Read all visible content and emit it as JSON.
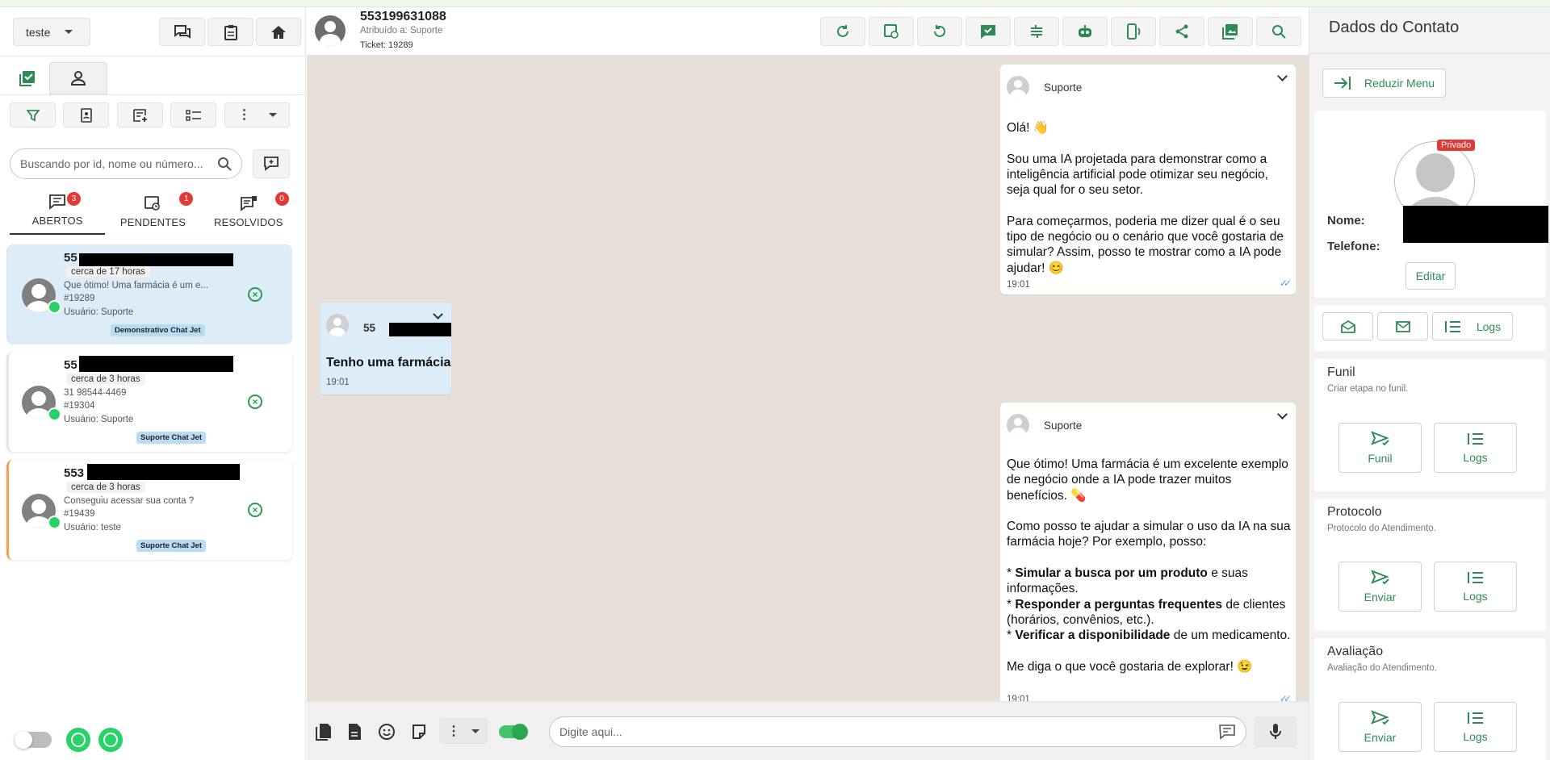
{
  "left": {
    "queue": "teste",
    "search_placeholder": "Buscando por id, nome ou número...",
    "tabs": [
      {
        "label": "ABERTOS",
        "badge": "3"
      },
      {
        "label": "PENDENTES",
        "badge": "1"
      },
      {
        "label": "RESOLVIDOS",
        "badge": "0"
      }
    ],
    "tickets": [
      {
        "number": "55",
        "time": "cerca de 17 horas",
        "preview": "Que ótimo! Uma farmácia é um e...",
        "id": "#19289",
        "user": "Usuário: Suporte",
        "tag": "Demonstrativo Chat Jet"
      },
      {
        "number": "55",
        "time": "cerca de 3 horas",
        "preview": "31 98544-4469",
        "id": "#19304",
        "user": "Usuário: Suporte",
        "tag": "Suporte Chat Jet"
      },
      {
        "number": "553",
        "time": "cerca de 3 horas",
        "preview": "Conseguiu acessar sua conta ?",
        "id": "#19439",
        "user": "Usuário: teste",
        "tag": "Suporte Chat Jet"
      }
    ]
  },
  "header": {
    "number": "553199631088",
    "assigned": "Atribuído a: Suporte",
    "ticket": "Ticket: 19289"
  },
  "messages": [
    {
      "sender": "Suporte",
      "body": "Olá! 👋\n\nSou uma IA projetada para demonstrar como a inteligência artificial pode otimizar seu negócio, seja qual for o seu setor.\n\nPara começarmos, poderia me dizer qual é o seu tipo de negócio ou o cenário que você gostaria de simular? Assim, posso te mostrar como a IA pode ajudar! 😊",
      "time": "19:01"
    },
    {
      "sender": "55",
      "body": "Tenho uma farmácia",
      "time": "19:01"
    },
    {
      "sender": "Suporte",
      "body_html": "Que ótimo! Uma farmácia é um excelente exemplo de negócio onde a IA pode trazer muitos benefícios. 💊\n\nComo posso te ajudar a simular o uso da IA na sua farmácia hoje? Por exemplo, posso:\n\n* <b>Simular a busca por um produto</b> e suas informações.\n* <b>Responder a perguntas frequentes</b> de clientes (horários, convênios, etc.).\n* <b>Verificar a disponibilidade</b> de um medicamento.\n\nMe diga o que você gostaria de explorar! 😉",
      "time": "19:01"
    }
  ],
  "composer": {
    "placeholder": "Digite aqui..."
  },
  "right": {
    "title": "Dados do Contato",
    "reduce": "Reduzir Menu",
    "private": "Privado",
    "name_label": "Nome:",
    "phone_label": "Telefone:",
    "edit": "Editar",
    "logs": "Logs",
    "sections": [
      {
        "title": "Funil",
        "subtitle": "Criar etapa no funil.",
        "action": "Funil",
        "logs": "Logs"
      },
      {
        "title": "Protocolo",
        "subtitle": "Protocolo do Atendimento.",
        "action": "Enviar",
        "logs": "Logs"
      },
      {
        "title": "Avaliação",
        "subtitle": "Avaliação do Atendimento.",
        "action": "Enviar",
        "logs": "Logs"
      }
    ]
  },
  "colors": {
    "accent_green": "#2e8b57",
    "badge_red": "#e53935",
    "chat_bg": "#e8e0d6",
    "selected_ticket": "#dcecf8",
    "tag_blue": "#b9dcf5"
  }
}
